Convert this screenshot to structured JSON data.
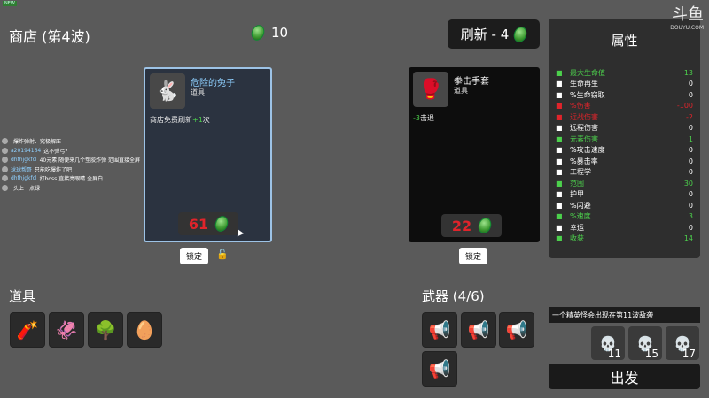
{
  "top_badge": "NEW",
  "shop": {
    "title": "商店 (第4波)",
    "materials": "10"
  },
  "refresh": {
    "label": "刷新 - 4"
  },
  "items": [
    {
      "name": "危险的兔子",
      "type": "道具",
      "desc_prefix": "商店免费刷新",
      "desc_value": "+1",
      "desc_suffix": "次",
      "price": "61",
      "lock_label": "锁定",
      "icon": "rabbit-icon",
      "name_color": "#8fd0ff"
    },
    {
      "name": "拳击手套",
      "type": "道具",
      "desc_prefix": "",
      "desc_value": "-3",
      "desc_suffix": "击退",
      "price": "22",
      "lock_label": "锁定",
      "icon": "boxing-glove-icon",
      "name_color": "#ffffff"
    }
  ],
  "stats": {
    "title": "属性",
    "rows": [
      {
        "label": "最大生命值",
        "value": "13",
        "color": "#4cd04c",
        "icon": "heart-icon"
      },
      {
        "label": "生命再生",
        "value": "0",
        "color": "#ffffff",
        "icon": "regen-icon"
      },
      {
        "label": "%生命窃取",
        "value": "0",
        "color": "#ffffff",
        "icon": "lifesteal-icon"
      },
      {
        "label": "%伤害",
        "value": "-100",
        "color": "#e0242b",
        "icon": "damage-icon"
      },
      {
        "label": "近战伤害",
        "value": "-2",
        "color": "#e0242b",
        "icon": "sword-icon"
      },
      {
        "label": "远程伤害",
        "value": "0",
        "color": "#ffffff",
        "icon": "bow-icon"
      },
      {
        "label": "元素伤害",
        "value": "1",
        "color": "#4cd04c",
        "icon": "flame-icon"
      },
      {
        "label": "%攻击速度",
        "value": "0",
        "color": "#ffffff",
        "icon": "hourglass-icon"
      },
      {
        "label": "%暴击率",
        "value": "0",
        "color": "#ffffff",
        "icon": "crit-icon"
      },
      {
        "label": "工程学",
        "value": "0",
        "color": "#ffffff",
        "icon": "wrench-icon"
      },
      {
        "label": "范围",
        "value": "30",
        "color": "#4cd04c",
        "icon": "range-icon"
      },
      {
        "label": "护甲",
        "value": "0",
        "color": "#ffffff",
        "icon": "shield-icon"
      },
      {
        "label": "%闪避",
        "value": "0",
        "color": "#ffffff",
        "icon": "dodge-icon"
      },
      {
        "label": "%速度",
        "value": "3",
        "color": "#4cd04c",
        "icon": "boot-icon"
      },
      {
        "label": "幸运",
        "value": "0",
        "color": "#ffffff",
        "icon": "clover-icon"
      },
      {
        "label": "收获",
        "value": "14",
        "color": "#4cd04c",
        "icon": "harvest-icon"
      }
    ]
  },
  "chat": [
    {
      "user": "",
      "text": "爆炸弹射、究极解压"
    },
    {
      "user": "a20194164",
      "text": "这不弹弓?"
    },
    {
      "user": "dhfhjgkfcl",
      "text": "40元素 随便来几个塑胶炸弹 范围直接全屏"
    },
    {
      "user": "球球帮哥",
      "text": "只能吃爆炸了吧"
    },
    {
      "user": "dhfhjgkfcl",
      "text": "打boss 直接亮眼睛 全屏白"
    },
    {
      "user": "",
      "text": "头上一点绿"
    }
  ],
  "inventory": {
    "title": "道具",
    "items": [
      {
        "icon": "dynamite-icon",
        "glyph": "🧨"
      },
      {
        "icon": "tentacle-icon",
        "glyph": "🦑"
      },
      {
        "icon": "tree-icon",
        "glyph": "🌳"
      },
      {
        "icon": "egg-mask-icon",
        "glyph": "🥚"
      }
    ]
  },
  "weapons": {
    "title": "武器 (4/6)",
    "items": [
      {
        "icon": "megaphone-icon",
        "glyph": "📢"
      },
      {
        "icon": "megaphone-icon",
        "glyph": "📢"
      },
      {
        "icon": "megaphone-icon",
        "glyph": "📢"
      },
      {
        "icon": "megaphone-icon",
        "glyph": "📢"
      }
    ]
  },
  "boss_note": "一个精英怪会出现在第11波敌袭",
  "bosses": [
    {
      "wave": "11"
    },
    {
      "wave": "15"
    },
    {
      "wave": "17"
    }
  ],
  "go_label": "出发",
  "logo": {
    "big": "斗鱼",
    "small": "DOUYU.COM"
  },
  "colors": {
    "background": "#5a5a5a",
    "price_red": "#e0242b",
    "green": "#4cd04c"
  }
}
